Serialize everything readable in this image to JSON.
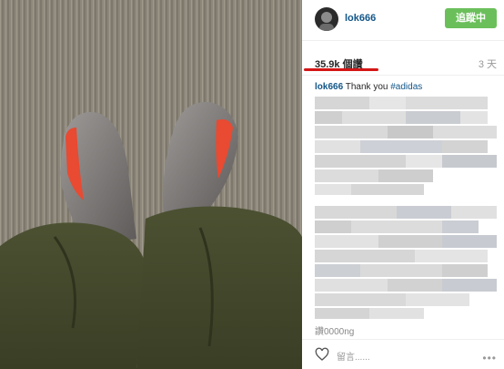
{
  "post": {
    "username": "lok666",
    "follow_label": "追蹤中",
    "likes": "35.9k 個讚",
    "age": "3 天",
    "caption_user": "lok666",
    "caption_text": "Thank you",
    "caption_tag": "#adidas",
    "more_text": "讚0000ng",
    "comment_placeholder": "留言......",
    "more_dots": "•••"
  },
  "colors": {
    "follow_bg": "#6bbf5b",
    "link": "#125688",
    "highlight_line": "#d41616"
  }
}
